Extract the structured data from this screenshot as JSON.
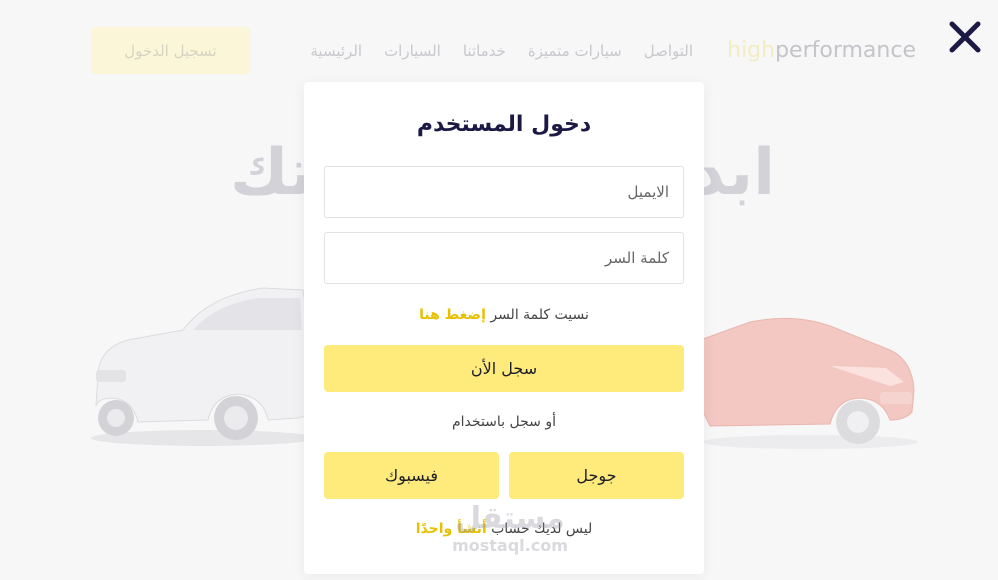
{
  "header": {
    "logo_highlight": "high",
    "logo_rest": "performance",
    "nav": [
      "الرئيسية",
      "السيارات",
      "خدماتنا",
      "سيارات متميزة",
      "التواصل"
    ],
    "signin_button": "تسجيل الدخول"
  },
  "hero": {
    "title_right": "ابد",
    "title_left": "تك"
  },
  "modal": {
    "title": "دخول المستخدم",
    "email_placeholder": "الايميل",
    "password_placeholder": "كلمة السر",
    "forgot_text": "نسيت كلمة السر",
    "forgot_link": "إضغط هنا",
    "submit_button": "سجل الأن",
    "or_text": "أو سجل باستخدام",
    "google_button": "جوجل",
    "facebook_button": "فيسبوك",
    "signup_text": "ليس لديك حساب",
    "signup_link": "أنشأ واحدًا"
  },
  "watermark": {
    "arabic": "مستقل",
    "english": "mostaql.com"
  },
  "colors": {
    "accent_yellow": "#ffeb7c",
    "link_yellow": "#e7c000",
    "title_navy": "#1c1a45",
    "close_navy": "#1c1a45"
  },
  "icons": {
    "close": "close-icon"
  }
}
